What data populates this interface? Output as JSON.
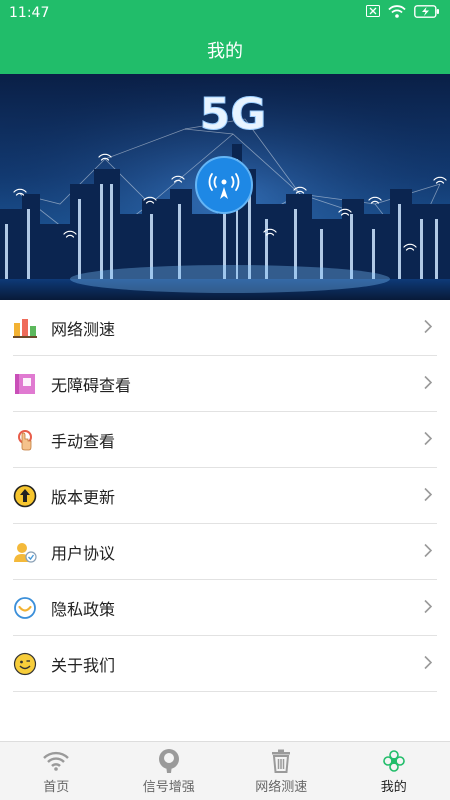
{
  "status_bar": {
    "time": "11:47",
    "icons": [
      "sim-off-icon",
      "wifi-icon",
      "battery-charging-icon"
    ]
  },
  "header": {
    "title": "我的"
  },
  "banner": {
    "headline": "5G",
    "icon": "signal-rocket-icon"
  },
  "menu": {
    "items": [
      {
        "label": "网络测速",
        "icon": "speed-test-icon"
      },
      {
        "label": "无障碍查看",
        "icon": "accessibility-book-icon"
      },
      {
        "label": "手动查看",
        "icon": "manual-hand-icon"
      },
      {
        "label": "版本更新",
        "icon": "update-arrow-icon"
      },
      {
        "label": "用户协议",
        "icon": "user-agreement-icon"
      },
      {
        "label": "隐私政策",
        "icon": "privacy-icon"
      },
      {
        "label": "关于我们",
        "icon": "about-smiley-icon"
      }
    ]
  },
  "tab_bar": {
    "items": [
      {
        "label": "首页",
        "icon": "wifi-home-icon"
      },
      {
        "label": "信号增强",
        "icon": "signal-boost-icon"
      },
      {
        "label": "网络测速",
        "icon": "trash-speed-icon"
      },
      {
        "label": "我的",
        "icon": "profile-flower-icon"
      }
    ],
    "active": "我的"
  },
  "colors": {
    "primary": "#21bd6a",
    "banner_circle": "#1e88e5",
    "active_tab": "#21bd6a"
  }
}
